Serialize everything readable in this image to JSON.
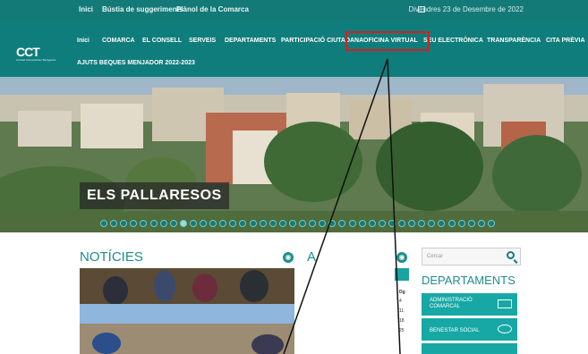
{
  "topbar": {
    "links": [
      "Inici",
      "Bústia de suggeriments",
      "Plànol de la Comarca"
    ],
    "date": "Divendres 23 de Desembre de 2022"
  },
  "logo": {
    "text": "CCT",
    "subtitle": "Consell Comarcal del Tarragonès"
  },
  "nav": {
    "items": [
      "Inici",
      "COMARCA",
      "EL CONSELL",
      "SERVEIS",
      "DEPARTAMENTS",
      "PARTICIPACIÓ CIUTADANA",
      "OFICINA VIRTUAL",
      "SEU ELECTRÒNICA",
      "TRANSPARÈNCIA",
      "CITA PRÈVIA"
    ],
    "second_row": "AJUTS BEQUES MENJADOR 2022-2023"
  },
  "hero": {
    "title": "ELS PALLARESOS",
    "slides": 40,
    "active_slide": 8
  },
  "news": {
    "title": "NOTÍCIES"
  },
  "agenda": {
    "title": "A",
    "days": [
      "Dg",
      "4",
      "11",
      "18",
      "25"
    ]
  },
  "search": {
    "placeholder": "Cercar"
  },
  "departments": {
    "title": "DEPARTAMENTS",
    "items": [
      "ADMINISTRACIÓ COMARCAL",
      "BENESTAR SOCIAL"
    ]
  },
  "colors": {
    "primary": "#0f7d7b",
    "accent": "#17a8a6",
    "highlight": "#d81e1e"
  }
}
